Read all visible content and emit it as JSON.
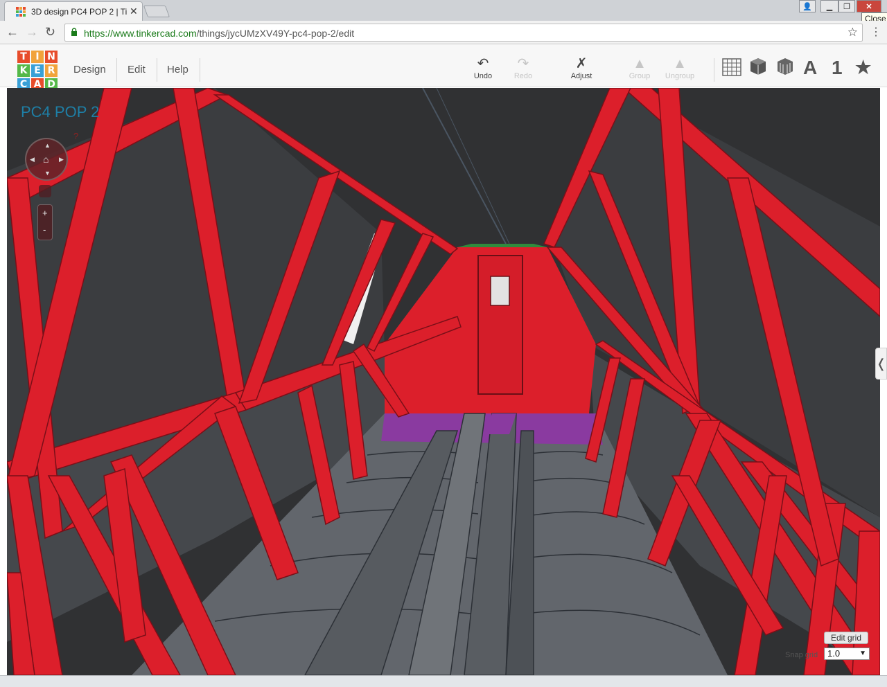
{
  "browser": {
    "tab_title": "3D design PC4 POP 2 | Ti",
    "tab_close": "✕",
    "url_secure": "https://www.tinkercad.com",
    "url_path": "/things/jycUMzXV49Y-pc4-pop-2/edit",
    "window_close": "✕",
    "window_close_tooltip": "Close",
    "window_min": "▁",
    "window_max": "❐",
    "window_user": "👤",
    "back": "←",
    "forward": "→",
    "reload": "↻",
    "bookmark": "☆",
    "menu": "⋮"
  },
  "logo": {
    "letters": [
      "T",
      "I",
      "N",
      "K",
      "E",
      "R",
      "C",
      "A",
      "D"
    ],
    "colors": [
      "#e74c2b",
      "#f1a33b",
      "#e74c2b",
      "#54b848",
      "#39a0d6",
      "#f1a33b",
      "#39a0d6",
      "#e74c2b",
      "#54b848"
    ]
  },
  "menu": {
    "design": "Design",
    "edit": "Edit",
    "help": "Help"
  },
  "tools": {
    "undo": "Undo",
    "redo": "Redo",
    "adjust": "Adjust",
    "group": "Group",
    "ungroup": "Ungroup"
  },
  "views": {
    "text": "A",
    "number": "1",
    "favorite": "★"
  },
  "workplane": {
    "design_name": "PC4 POP 2",
    "help_mark": "?",
    "zoom_in": "+",
    "zoom_out": "-",
    "collapse": "❬",
    "edit_grid": "Edit grid",
    "snap_label": "Snap grid",
    "snap_value": "1.0",
    "snap_caret": "▼"
  },
  "colors": {
    "frame_red": "#d81e2a",
    "frame_dark": "#9d1520",
    "floor_gray": "#5d6167",
    "purple": "#8a3aa0",
    "background": "#303133",
    "title_blue": "#1e7fa6"
  }
}
